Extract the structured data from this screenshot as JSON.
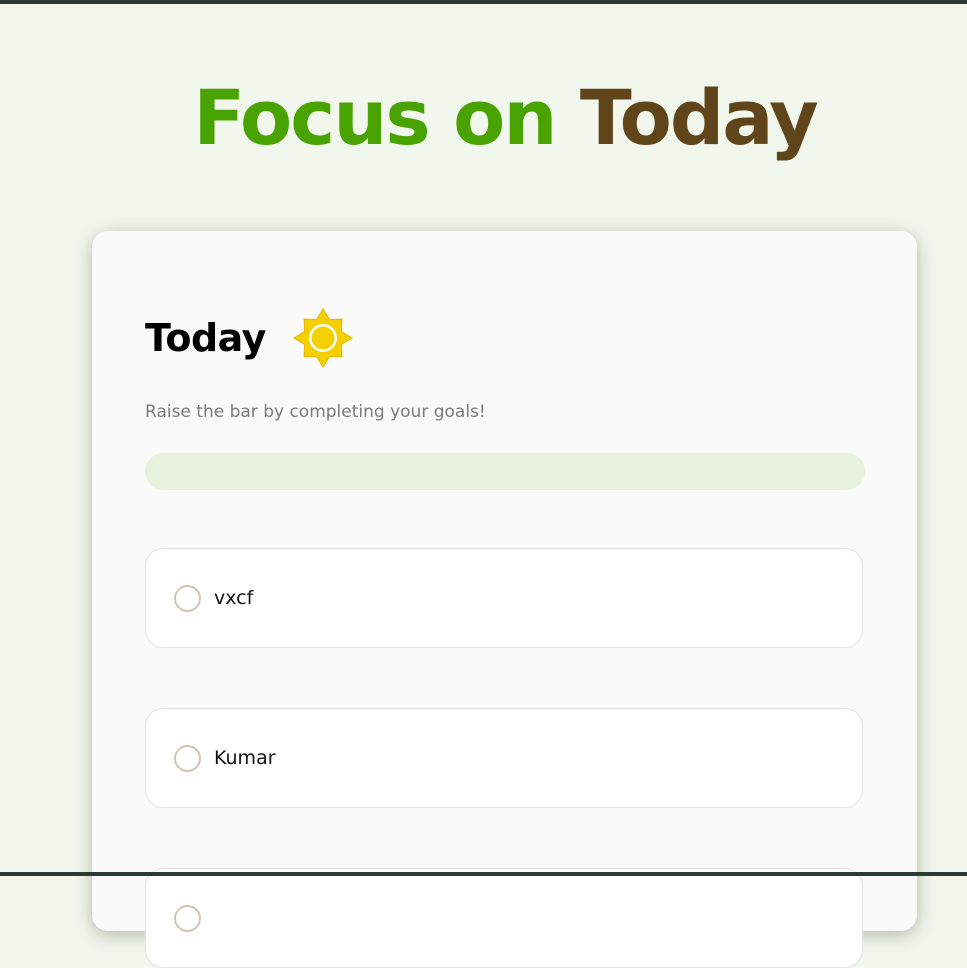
{
  "header": {
    "title_part1": "Focus on",
    "title_part2": "Today"
  },
  "card": {
    "title": "Today",
    "icon": "sun-icon",
    "subtitle": "Raise the bar by completing your goals!",
    "progress": 0,
    "goals": [
      {
        "text": "vxcf",
        "completed": false
      },
      {
        "text": "Kumar",
        "completed": false
      },
      {
        "text": "",
        "completed": false
      }
    ]
  },
  "colors": {
    "page_background": "#f2f7ee",
    "accent_green": "#48a300",
    "accent_brown": "#5f4519",
    "progress_track": "#e8f1de",
    "sun": "#f5d000",
    "checkbox_border": "#cfc5b5"
  }
}
